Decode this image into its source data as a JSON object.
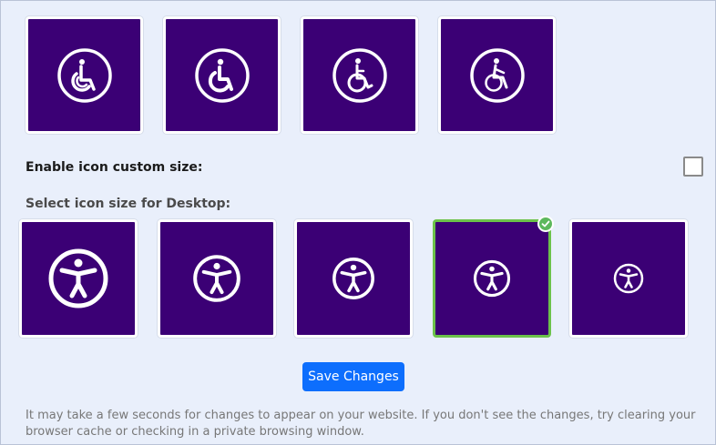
{
  "wheelchair_icons": [
    {
      "name": "wheelchair-icon-1"
    },
    {
      "name": "wheelchair-icon-2"
    },
    {
      "name": "wheelchair-icon-3"
    },
    {
      "name": "wheelchair-icon-4"
    }
  ],
  "custom_size": {
    "label": "Enable icon custom size:",
    "checked": false
  },
  "desktop_size": {
    "label": "Select icon size for Desktop:",
    "options": [
      {
        "icon": "accessibility-person-icon",
        "selected": false
      },
      {
        "icon": "accessibility-person-icon",
        "selected": false
      },
      {
        "icon": "accessibility-person-icon",
        "selected": false
      },
      {
        "icon": "accessibility-person-icon",
        "selected": true
      },
      {
        "icon": "accessibility-person-icon",
        "selected": false
      }
    ]
  },
  "save_button": {
    "label": "Save Changes"
  },
  "note": "It may take a few seconds for changes to appear on your website. If you don't see the changes, try clearing your browser cache or checking in a private browsing window.",
  "colors": {
    "tile_bg": "#3b0075",
    "selected_border": "#6cc24a",
    "button": "#0d6efd",
    "page_bg": "#e9effb"
  }
}
